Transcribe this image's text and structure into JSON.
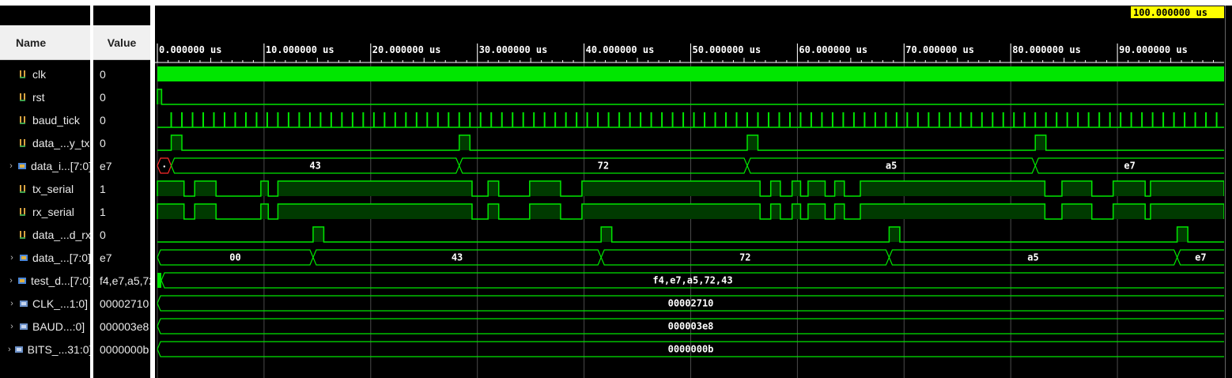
{
  "columns": {
    "name": "Name",
    "value": "Value"
  },
  "cursor_label": "100.000000 us",
  "time_axis": {
    "unit": "us",
    "start": 0,
    "end": 100,
    "labels": [
      "0.000000 us",
      "10.000000 us",
      "20.000000 us",
      "30.000000 us",
      "40.000000 us",
      "50.000000 us",
      "60.000000 us",
      "70.000000 us",
      "80.000000 us",
      "90.000000 us"
    ],
    "major_times": [
      0,
      10,
      20,
      30,
      40,
      50,
      60,
      70,
      80,
      90
    ]
  },
  "colors": {
    "wave": "#00e600",
    "bus_fill": "#003a00",
    "error": "#ff2a2a",
    "cursor_bg": "#ffff00",
    "header_bg": "#f0f0f0"
  },
  "signals": [
    {
      "name": "clk",
      "value": "0",
      "kind": "bit",
      "expandable": false,
      "icon": "bit-signal-icon"
    },
    {
      "name": "rst",
      "value": "0",
      "kind": "bit",
      "expandable": false,
      "icon": "bit-signal-icon"
    },
    {
      "name": "baud_tick",
      "value": "0",
      "kind": "bit",
      "expandable": false,
      "icon": "bit-signal-icon"
    },
    {
      "name": "data_...y_tx",
      "value": "0",
      "kind": "bit",
      "expandable": false,
      "icon": "bit-signal-icon"
    },
    {
      "name": "data_i...[7:0]",
      "value": "e7",
      "kind": "bus",
      "expandable": true,
      "icon": "bus-signal-icon"
    },
    {
      "name": "tx_serial",
      "value": "1",
      "kind": "bit",
      "expandable": false,
      "icon": "bit-signal-icon"
    },
    {
      "name": "rx_serial",
      "value": "1",
      "kind": "bit",
      "expandable": false,
      "icon": "bit-signal-icon"
    },
    {
      "name": "data_...d_rx",
      "value": "0",
      "kind": "bit",
      "expandable": false,
      "icon": "bit-signal-icon"
    },
    {
      "name": "data_...[7:0]",
      "value": "e7",
      "kind": "bus",
      "expandable": true,
      "icon": "bus-signal-icon"
    },
    {
      "name": "test_d...[7:0]",
      "value": "f4,e7,a5,72,43",
      "kind": "bus",
      "expandable": true,
      "icon": "bus-signal-icon"
    },
    {
      "name": "CLK_...1:0]",
      "value": "00002710",
      "kind": "bus",
      "expandable": true,
      "icon": "param-signal-icon"
    },
    {
      "name": "BAUD...:0]",
      "value": "000003e8",
      "kind": "bus",
      "expandable": true,
      "icon": "param-signal-icon"
    },
    {
      "name": "BITS_...31:0]",
      "value": "0000000b",
      "kind": "bus",
      "expandable": true,
      "icon": "param-signal-icon"
    }
  ],
  "waves": {
    "clk": {
      "type": "solid"
    },
    "rst": {
      "type": "pulses",
      "pulses": [
        [
          0,
          0.4
        ]
      ]
    },
    "baud_tick": {
      "type": "ticks",
      "start": 1.3,
      "period": 1.0,
      "end": 100
    },
    "data_ready_tx": {
      "type": "pulses",
      "pulses": [
        [
          1.3,
          2.3
        ],
        [
          28.3,
          29.3
        ],
        [
          55.3,
          56.3
        ],
        [
          82.3,
          83.3
        ]
      ]
    },
    "data_in": {
      "type": "bus",
      "segments": [
        {
          "from": 0,
          "to": 1.3,
          "label": "",
          "error": true
        },
        {
          "from": 1.3,
          "to": 28.3,
          "label": "43"
        },
        {
          "from": 28.3,
          "to": 55.3,
          "label": "72"
        },
        {
          "from": 55.3,
          "to": 82.3,
          "label": "a5"
        },
        {
          "from": 82.3,
          "to": 100,
          "label": "e7"
        }
      ]
    },
    "tx_serial": {
      "type": "pulses",
      "pulses": [
        [
          0,
          2.5
        ],
        [
          3.5,
          5.5
        ],
        [
          9.7,
          10.4
        ],
        [
          11.3,
          29.5
        ],
        [
          31.0,
          32.0
        ],
        [
          34.9,
          37.8
        ],
        [
          39.8,
          56.5
        ],
        [
          57.5,
          58.4
        ],
        [
          59.5,
          60.3
        ],
        [
          61.0,
          62.6
        ],
        [
          63.5,
          64.4
        ],
        [
          65.9,
          83.2
        ],
        [
          84.8,
          87.6
        ],
        [
          89.6,
          92.6
        ],
        [
          93.1,
          100
        ]
      ]
    },
    "rx_serial": {
      "type": "pulses",
      "pulses": [
        [
          0,
          2.5
        ],
        [
          3.5,
          5.5
        ],
        [
          9.7,
          10.4
        ],
        [
          11.3,
          29.5
        ],
        [
          31.0,
          32.0
        ],
        [
          34.9,
          37.8
        ],
        [
          39.8,
          56.5
        ],
        [
          57.5,
          58.4
        ],
        [
          59.5,
          60.3
        ],
        [
          61.0,
          62.6
        ],
        [
          63.5,
          64.4
        ],
        [
          65.9,
          83.2
        ],
        [
          84.8,
          87.6
        ],
        [
          89.6,
          92.6
        ],
        [
          93.1,
          100
        ]
      ]
    },
    "data_valid_rx": {
      "type": "pulses",
      "pulses": [
        [
          14.6,
          15.6
        ],
        [
          41.6,
          42.6
        ],
        [
          68.6,
          69.6
        ],
        [
          95.6,
          96.6
        ]
      ]
    },
    "data_out": {
      "type": "bus",
      "segments": [
        {
          "from": 0,
          "to": 14.6,
          "label": "00"
        },
        {
          "from": 14.6,
          "to": 41.6,
          "label": "43"
        },
        {
          "from": 41.6,
          "to": 68.6,
          "label": "72"
        },
        {
          "from": 68.6,
          "to": 95.6,
          "label": "a5"
        },
        {
          "from": 95.6,
          "to": 100,
          "label": "e7"
        }
      ]
    },
    "test_data": {
      "type": "bus",
      "marker": true,
      "segments": [
        {
          "from": 0,
          "to": 100,
          "label": "f4,e7,a5,72,43"
        }
      ]
    },
    "CLK_FREQ": {
      "type": "bus",
      "segments": [
        {
          "from": 0,
          "to": 100,
          "label": "00002710"
        }
      ]
    },
    "BAUD_RATE": {
      "type": "bus",
      "segments": [
        {
          "from": 0,
          "to": 100,
          "label": "000003e8"
        }
      ]
    },
    "BITS": {
      "type": "bus",
      "segments": [
        {
          "from": 0,
          "to": 100,
          "label": "0000000b"
        }
      ]
    }
  }
}
